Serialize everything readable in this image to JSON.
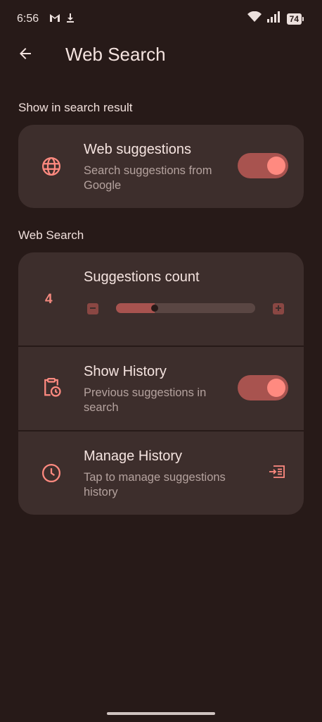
{
  "status_bar": {
    "time": "6:56",
    "left_icons": [
      "gmail-icon",
      "download-icon"
    ],
    "right_icons": [
      "wifi-icon",
      "signal-icon"
    ],
    "battery": "74"
  },
  "app_bar": {
    "title": "Web Search",
    "back_icon": "arrow-back-icon"
  },
  "sections": {
    "show_in_results": {
      "header": "Show in search result",
      "web_suggestions": {
        "title": "Web suggestions",
        "subtitle": "Search suggestions from Google",
        "icon": "globe-icon",
        "enabled": true
      }
    },
    "web_search": {
      "header": "Web Search",
      "suggestions_count": {
        "title": "Suggestions count",
        "value": "4",
        "slider_fraction": 0.27,
        "minus_icon": "minus-icon",
        "plus_icon": "plus-icon"
      },
      "show_history": {
        "title": "Show History",
        "subtitle": "Previous suggestions in search",
        "icon": "clipboard-clock-icon",
        "enabled": true
      },
      "manage_history": {
        "title": "Manage History",
        "subtitle": "Tap to manage suggestions history",
        "icon": "clock-icon",
        "action_icon": "open-list-icon"
      }
    }
  },
  "colors": {
    "background": "#271a18",
    "card": "#3d2e2c",
    "accent": "#ff8a80",
    "switch_track": "#a8534f"
  }
}
